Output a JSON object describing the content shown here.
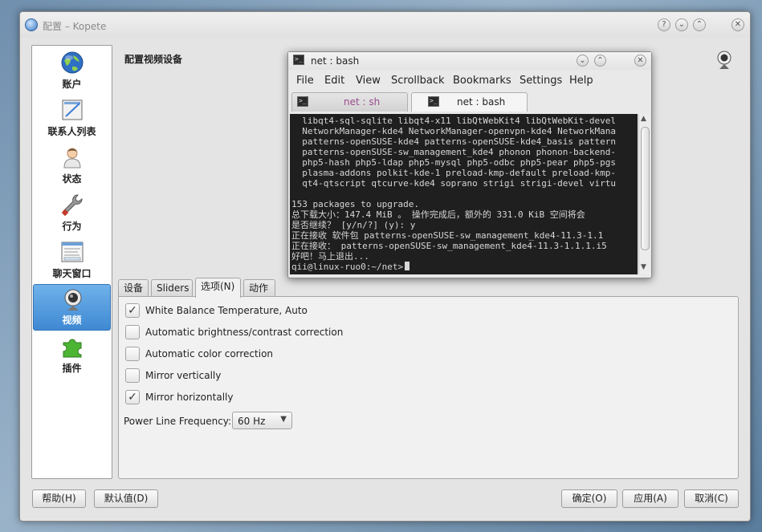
{
  "window": {
    "title": "配置 – Kopete",
    "buttons": {
      "help": "?",
      "minimize": "⌄",
      "maximize": "⌃",
      "close": "✕"
    }
  },
  "sidebar": {
    "items": [
      {
        "label": "账户",
        "icon": "globe-icon"
      },
      {
        "label": "联系人列表",
        "icon": "contact-list-icon"
      },
      {
        "label": "状态",
        "icon": "person-icon"
      },
      {
        "label": "行为",
        "icon": "wrench-icon"
      },
      {
        "label": "聊天窗口",
        "icon": "chat-window-icon"
      },
      {
        "label": "视频",
        "icon": "webcam-icon",
        "selected": true
      },
      {
        "label": "插件",
        "icon": "puzzle-icon"
      }
    ]
  },
  "main": {
    "title": "配置视频设备",
    "tabs": [
      {
        "label": "设备"
      },
      {
        "label": "Sliders"
      },
      {
        "label": "选项(N)",
        "active": true
      },
      {
        "label": "动作"
      }
    ],
    "options": [
      {
        "label": "White Balance Temperature, Auto",
        "checked": true
      },
      {
        "label": "Automatic brightness/contrast correction",
        "checked": false
      },
      {
        "label": "Automatic color correction",
        "checked": false
      },
      {
        "label": "Mirror vertically",
        "checked": false
      },
      {
        "label": "Mirror horizontally",
        "checked": true
      }
    ],
    "power_line": {
      "label": "Power Line Frequency:",
      "value": "60 Hz"
    }
  },
  "footer": {
    "help": "帮助(H)",
    "defaults": "默认值(D)",
    "ok": "确定(O)",
    "apply": "应用(A)",
    "cancel": "取消(C)"
  },
  "konsole": {
    "title": "net : bash",
    "menu": [
      "File",
      "Edit",
      "View",
      "Scrollback",
      "Bookmarks",
      "Settings",
      "Help"
    ],
    "tabs": [
      {
        "label": "net : sh",
        "active": false
      },
      {
        "label": "net : bash",
        "active": true
      }
    ],
    "lines": [
      "  libqt4-sql-sqlite libqt4-x11 libQtWebKit4 libQtWebKit-devel",
      "  NetworkManager-kde4 NetworkManager-openvpn-kde4 NetworkMana",
      "  patterns-openSUSE-kde4 patterns-openSUSE-kde4_basis pattern",
      "  patterns-openSUSE-sw_management_kde4 phonon phonon-backend-",
      "  php5-hash php5-ldap php5-mysql php5-odbc php5-pear php5-pgs",
      "  plasma-addons polkit-kde-1 preload-kmp-default preload-kmp-",
      "  qt4-qtscript qtcurve-kde4 soprano strigi strigi-devel virtu",
      "",
      "153 packages to upgrade.",
      "总下载大小：147.4 MiB 。 操作完成后，额外的 331.0 KiB 空间将会",
      "是否继续？ [y/n/?] (y): y",
      "正在接收 软件包 patterns-openSUSE-sw_management_kde4-11.3-1.1",
      "正在接收： patterns-openSUSE-sw_management_kde4-11.3-1.1.1.i5",
      "好吧！马上退出...",
      "qii@linux-ruo0:~/net>"
    ]
  }
}
